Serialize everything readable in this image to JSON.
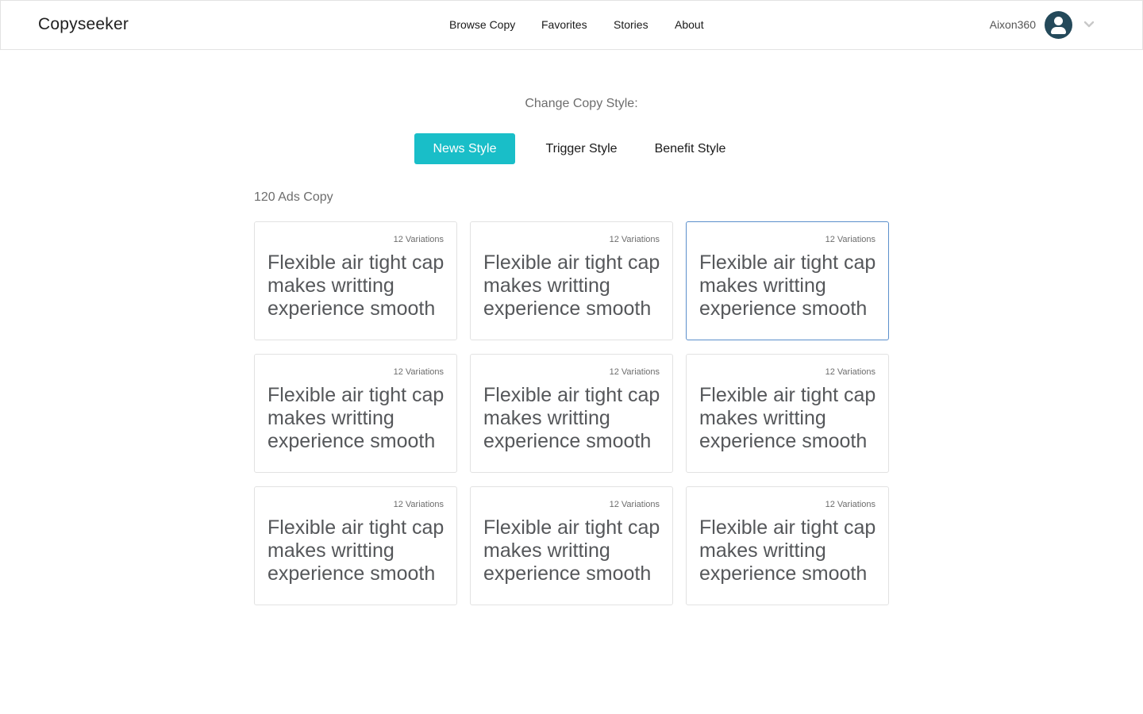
{
  "header": {
    "logo": "Copyseeker",
    "nav": [
      "Browse Copy",
      "Favorites",
      "Stories",
      "About"
    ],
    "user_name": "Aixon360"
  },
  "main": {
    "style_label": "Change Copy Style:",
    "styles": [
      "News Style",
      "Trigger Style",
      "Benefit Style"
    ],
    "active_style": "News Style",
    "count_label": "120 Ads Copy",
    "cards": [
      {
        "variations": "12 Variations",
        "copy": "Flexible air tight cap makes writting experience smooth"
      },
      {
        "variations": "12 Variations",
        "copy": "Flexible air tight cap makes writting experience smooth"
      },
      {
        "variations": "12 Variations",
        "copy": "Flexible air tight cap makes writting experience smooth"
      },
      {
        "variations": "12 Variations",
        "copy": "Flexible air tight cap makes writting experience smooth"
      },
      {
        "variations": "12 Variations",
        "copy": "Flexible air tight cap makes writting experience smooth"
      },
      {
        "variations": "12 Variations",
        "copy": "Flexible air tight cap makes writting experience smooth"
      },
      {
        "variations": "12 Variations",
        "copy": "Flexible air tight cap makes writting experience smooth"
      },
      {
        "variations": "12 Variations",
        "copy": "Flexible air tight cap makes writting experience smooth"
      },
      {
        "variations": "12 Variations",
        "copy": "Flexible air tight cap makes writting experience smooth"
      }
    ]
  },
  "colors": {
    "accent": "#19bec8",
    "avatar": "#24495a",
    "selected_border": "#5b8fcc"
  },
  "icons": [
    "user-icon",
    "chevron-down-icon"
  ]
}
